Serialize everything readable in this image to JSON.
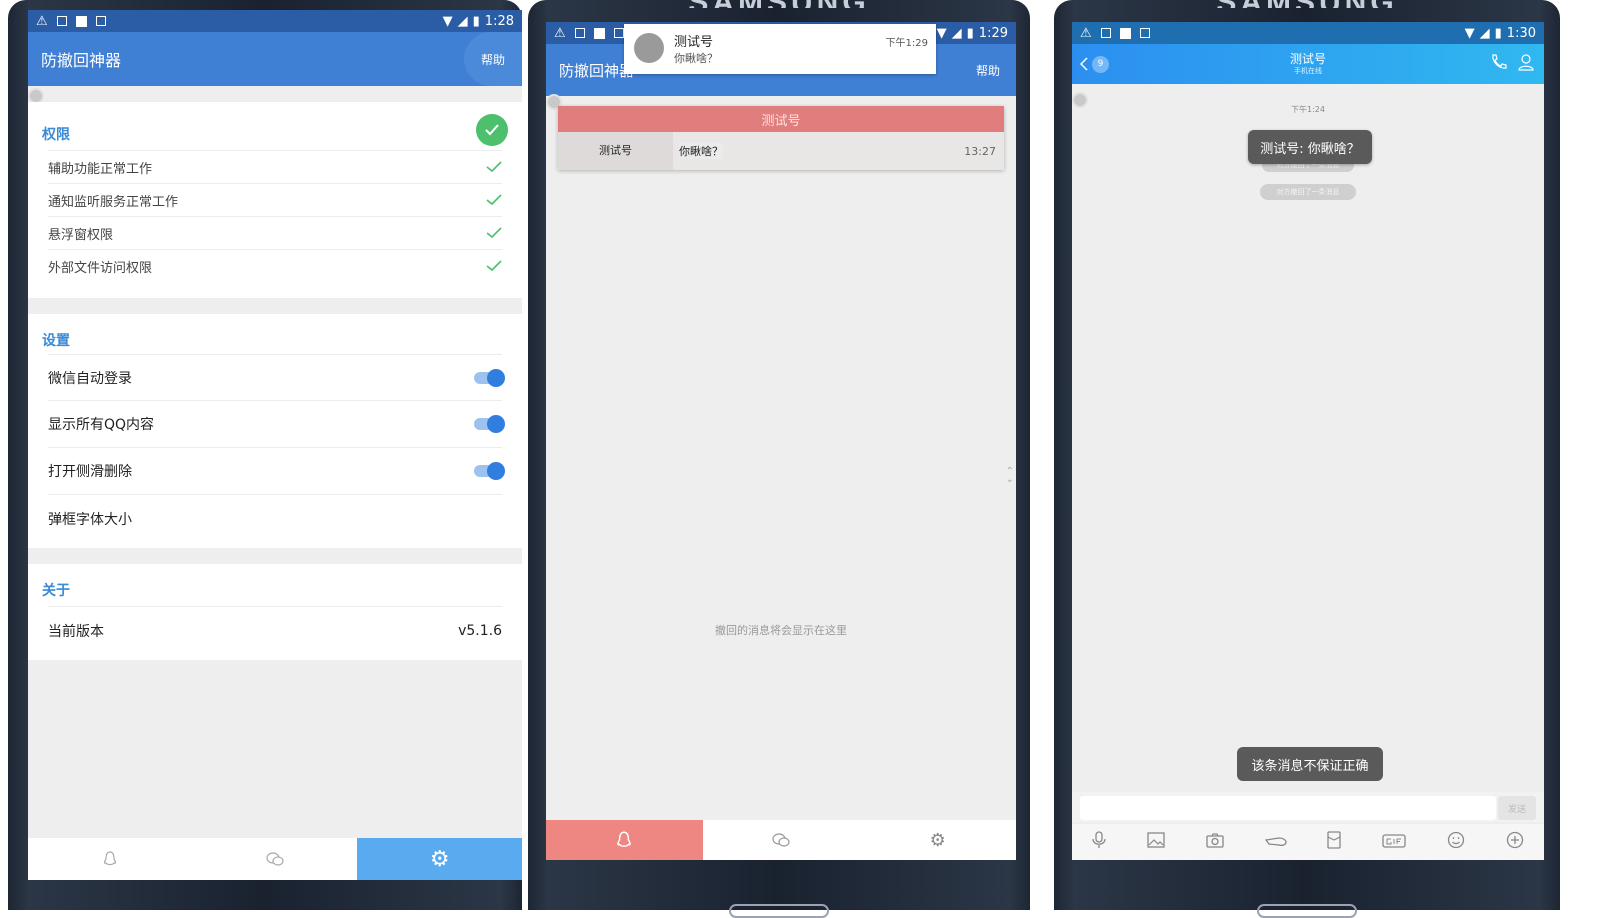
{
  "panel1": {
    "status_time": "1:28",
    "app_title": "防撤回神器",
    "help_label": "帮助",
    "permissions": {
      "title": "权限",
      "items": [
        {
          "label": "辅助功能正常工作"
        },
        {
          "label": "通知监听服务正常工作"
        },
        {
          "label": "悬浮窗权限"
        },
        {
          "label": "外部文件访问权限"
        }
      ]
    },
    "settings": {
      "title": "设置",
      "items": [
        {
          "label": "微信自动登录",
          "toggle": true
        },
        {
          "label": "显示所有QQ内容",
          "toggle": true
        },
        {
          "label": "打开侧滑删除",
          "toggle": true
        },
        {
          "label": "弹框字体大小"
        }
      ]
    },
    "about": {
      "title": "关于",
      "version_label": "当前版本",
      "version_value": "v5.1.6"
    },
    "nav": {
      "active": "settings"
    }
  },
  "panel2": {
    "status_time": "1:29",
    "app_title": "防撤回神器",
    "help_label": "帮助",
    "notification": {
      "title": "测试号",
      "text": "你瞅啥？",
      "time": "下午1:29"
    },
    "record_card": {
      "header": "测试号",
      "sender": "测试号",
      "message": "你瞅啥？",
      "time": "13:27"
    },
    "empty_hint": "撤回的消息将会显示在这里",
    "nav": {
      "active": "qq"
    }
  },
  "panel3": {
    "status_time": "1:30",
    "back_count": "9",
    "contact_name": "测试号",
    "contact_status": "手机在线",
    "chat_time": "下午1:24",
    "popup_text": "测试号: 你瞅啥？",
    "system_notice_behind": "对方撤回了一条消息",
    "system_notice": "对方撤回了一条消息",
    "toast_text": "该条消息不保证正确",
    "send_label": "发送",
    "toolbar": [
      "mic-icon",
      "image-icon",
      "camera-icon",
      "hongbao-icon",
      "redpacket-icon",
      "gif-icon",
      "emoji-icon",
      "plus-icon"
    ]
  },
  "colors": {
    "blue_primary": "#3f7fd4",
    "blue_active_tab": "#5aaaf0",
    "section_title": "#3a8ad6",
    "check_green": "#4cc06c",
    "toggle_blue": "#2f7ee0",
    "pink_header": "#e07e7e",
    "pink_active_tab": "#ee8682",
    "qq_header": "#2ea9f0"
  }
}
